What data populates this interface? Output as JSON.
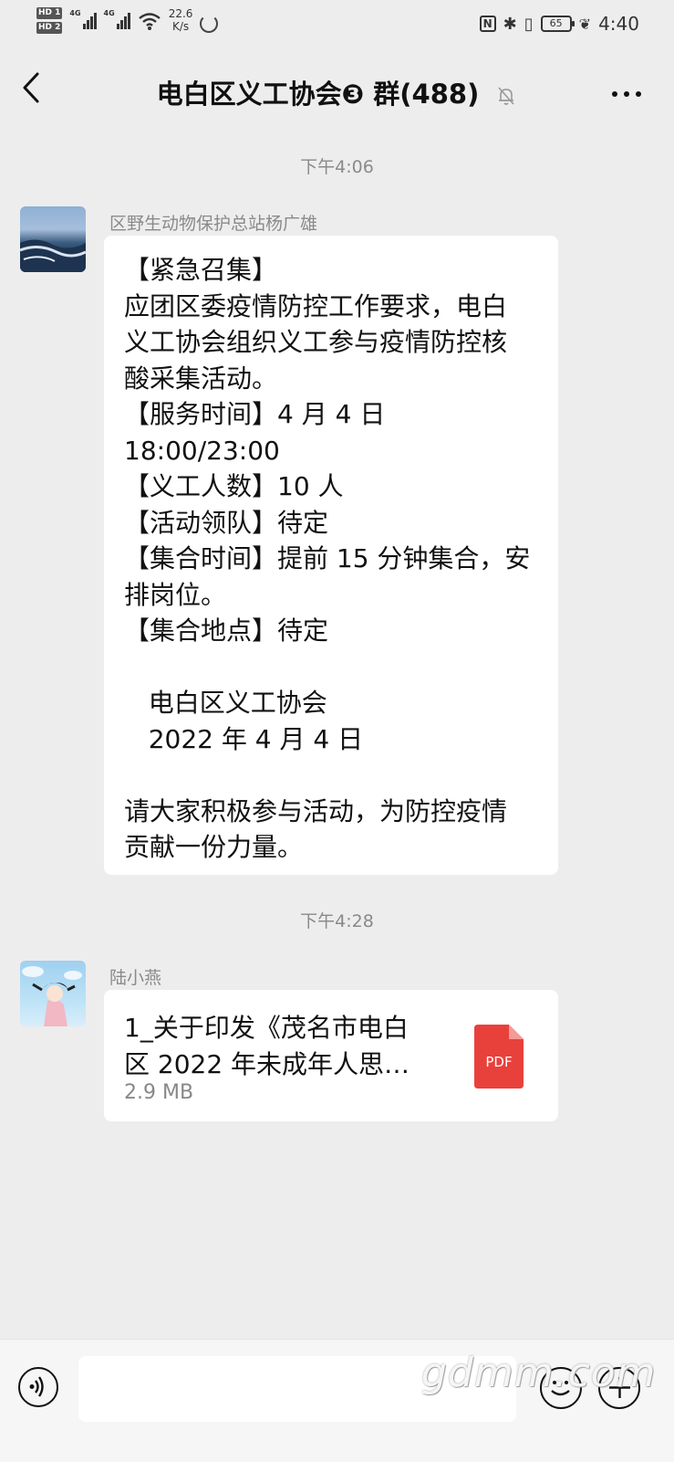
{
  "status_bar": {
    "hd1": "HD 1",
    "hd2": "HD 2",
    "net1": "4G",
    "net2": "4G",
    "speed_value": "22.6",
    "speed_unit": "K/s",
    "battery": "65",
    "time": "4:40",
    "icons": [
      "nfc-icon",
      "bluetooth-icon",
      "vibrate-icon",
      "battery-icon",
      "leaf-icon"
    ]
  },
  "title_bar": {
    "title": "电白区义工协会❸ 群(488)",
    "back_icon": "chevron-left-icon",
    "mute_icon": "bell-off-icon",
    "more_icon": "more-icon"
  },
  "chat": {
    "time1": "下午4:06",
    "msg1": {
      "sender": "区野生动物保护总站杨广雄",
      "lines": [
        "【紧急召集】",
        "应团区委疫情防控工作要求，电白",
        "义工协会组织义工参与疫情防控核",
        "酸采集活动。",
        "【服务时间】4 月 4 日",
        "18:00/23:00",
        "【义工人数】10 人",
        "【活动领队】待定",
        "【集合时间】提前 15 分钟集合，安",
        "排岗位。",
        "【集合地点】待定",
        "",
        "   电白区义工协会",
        "   2022 年 4 月 4 日",
        "",
        "请大家积极参与活动，为防控疫情",
        "贡献一份力量。"
      ]
    },
    "time2": "下午4:28",
    "msg2": {
      "sender": "陆小燕",
      "file_name_line1": "1_关于印发《茂名市电白",
      "file_name_line2": "区 2022 年未成年人思…",
      "file_size": "2.9 MB",
      "file_type": "PDF"
    }
  },
  "bottom_bar": {
    "voice_icon": "voice-icon",
    "emoji_icon": "emoji-icon",
    "plus_icon": "plus-icon",
    "input_value": ""
  },
  "watermark": "gdmm.com",
  "colors": {
    "background": "#ededed",
    "bubble": "#ffffff",
    "pdf_red": "#e8413c"
  }
}
